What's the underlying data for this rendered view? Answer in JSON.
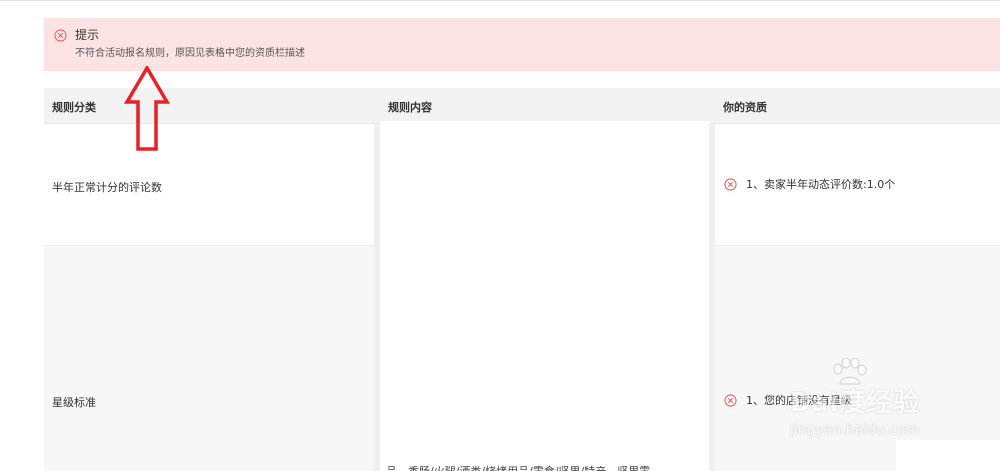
{
  "alert": {
    "title": "提示",
    "message": "不符合活动报名规则，原因见表格中您的资质栏描述",
    "icon": "error-circle-icon",
    "color": "#e06060"
  },
  "table": {
    "headers": [
      "规则分类",
      "规则内容",
      "你的资质"
    ],
    "rows": [
      {
        "category": "半年正常计分的评论数",
        "qualification": "1、卖家半年动态评价数:1.0个"
      },
      {
        "category": "星级标准",
        "qualification": "1、您的店铺没有星级"
      }
    ],
    "content_partial": "品，香肠/火腿/酒类/烧烤用品/零食/坚果/特产，坚果零"
  },
  "annotation": {
    "icon": "red-up-arrow-icon",
    "color": "#e8202a"
  },
  "watermark": {
    "brand": "Bai度经验",
    "url": "jingyan.baidu.com",
    "icon": "baidu-paw-icon"
  }
}
